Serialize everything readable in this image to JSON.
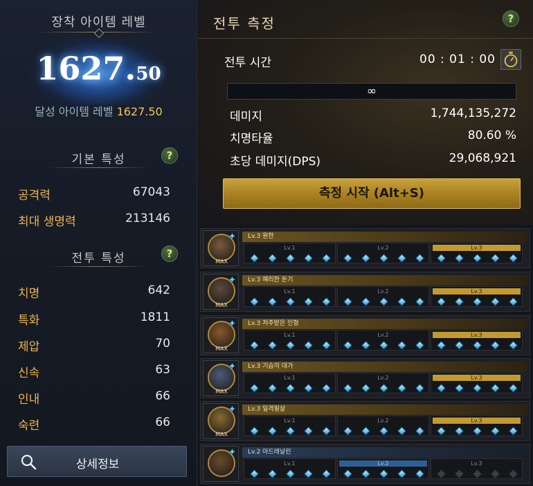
{
  "left": {
    "item_level_title": "장착 아이템 레벨",
    "item_level_int": "1627.",
    "item_level_dec": "50",
    "achieved_label": "달성 아이템 레벨",
    "achieved_value": "1627.50",
    "basic_section_title": "기본 특성",
    "basic_stats": [
      {
        "label": "공격력",
        "value": "67043"
      },
      {
        "label": "최대 생명력",
        "value": "213146"
      }
    ],
    "combat_section_title": "전투 특성",
    "combat_stats": [
      {
        "label": "치명",
        "value": "642"
      },
      {
        "label": "특화",
        "value": "1811"
      },
      {
        "label": "제압",
        "value": "70"
      },
      {
        "label": "신속",
        "value": "63"
      },
      {
        "label": "인내",
        "value": "66"
      },
      {
        "label": "숙련",
        "value": "66"
      }
    ],
    "detail_button": "상세정보",
    "help_glyph": "?"
  },
  "battle": {
    "title": "전투 측정",
    "time_label": "전투 시간",
    "time_value": "00 : 01 : 00",
    "infinity": "∞",
    "metrics": [
      {
        "label": "데미지",
        "value": "1,744,135,272"
      },
      {
        "label": "치명타율",
        "value": "80.60 %"
      },
      {
        "label": "초당 데미지(DPS)",
        "value": "29,068,921"
      }
    ],
    "start_button": "측정 시작 (Alt+S)",
    "help_glyph": "?"
  },
  "engravings": [
    {
      "name": "Lv.3 원한",
      "active_level": 3,
      "filled_gems": 15,
      "max_label": "MAX",
      "portrait_color": "#7a5a3a"
    },
    {
      "name": "Lv.3 예리한 둔기",
      "active_level": 3,
      "filled_gems": 15,
      "max_label": "MAX",
      "portrait_color": "#5d4a3c"
    },
    {
      "name": "Lv.3 저주받은 인형",
      "active_level": 3,
      "filled_gems": 15,
      "max_label": "MAX",
      "portrait_color": "#8a5a2a"
    },
    {
      "name": "Lv.3 기습의 대가",
      "active_level": 3,
      "filled_gems": 15,
      "max_label": "MAX",
      "portrait_color": "#4f5a78"
    },
    {
      "name": "Lv.3 일격필살",
      "active_level": 3,
      "filled_gems": 15,
      "max_label": "MAX",
      "portrait_color": "#8a6a30"
    },
    {
      "name": "Lv.2 아드레날린",
      "active_level": 2,
      "filled_gems": 10,
      "max_label": "",
      "portrait_color": "#6a4a2a"
    }
  ],
  "level_labels": [
    "Lv.1",
    "Lv.2",
    "Lv.3"
  ],
  "colors": {
    "accent_gold": "#f0b44a",
    "gem_blue": "#2f9edb",
    "button_gold": "#c7a13c"
  }
}
